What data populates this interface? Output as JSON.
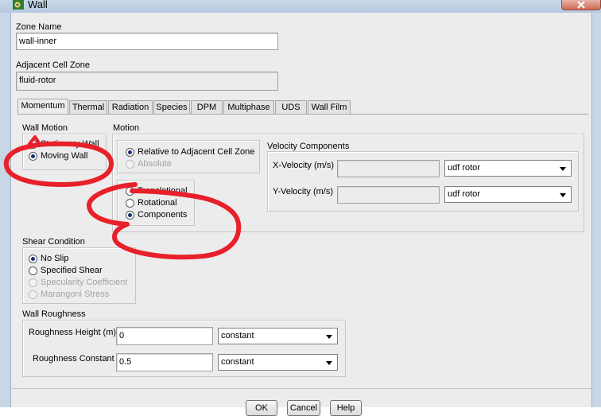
{
  "window": {
    "title": "Wall"
  },
  "zone_name": {
    "label": "Zone Name",
    "value": "wall-inner"
  },
  "adjacent_cell_zone": {
    "label": "Adjacent Cell Zone",
    "value": "fluid-rotor"
  },
  "tabs": [
    {
      "label": "Momentum",
      "active": true
    },
    {
      "label": "Thermal",
      "active": false
    },
    {
      "label": "Radiation",
      "active": false
    },
    {
      "label": "Species",
      "active": false
    },
    {
      "label": "DPM",
      "active": false
    },
    {
      "label": "Multiphase",
      "active": false
    },
    {
      "label": "UDS",
      "active": false
    },
    {
      "label": "Wall Film",
      "active": false
    }
  ],
  "wall_motion": {
    "title": "Wall Motion",
    "options": [
      {
        "label": "Stationary Wall",
        "selected": false
      },
      {
        "label": "Moving Wall",
        "selected": true
      }
    ]
  },
  "motion": {
    "title": "Motion",
    "reference": [
      {
        "label": "Relative to Adjacent Cell Zone",
        "selected": true,
        "enabled": true
      },
      {
        "label": "Absolute",
        "selected": false,
        "enabled": false
      }
    ],
    "type": [
      {
        "label": "Translational",
        "selected": false
      },
      {
        "label": "Rotational",
        "selected": false
      },
      {
        "label": "Components",
        "selected": true
      }
    ]
  },
  "velocity_components": {
    "title": "Velocity Components",
    "x": {
      "label": "X-Velocity (m/s)",
      "value": "",
      "method": "udf rotor"
    },
    "y": {
      "label": "Y-Velocity (m/s)",
      "value": "",
      "method": "udf rotor"
    }
  },
  "shear_condition": {
    "title": "Shear Condition",
    "options": [
      {
        "label": "No Slip",
        "selected": true,
        "enabled": true
      },
      {
        "label": "Specified Shear",
        "selected": false,
        "enabled": true
      },
      {
        "label": "Specularity Coefficient",
        "selected": false,
        "enabled": false
      },
      {
        "label": "Marangoni Stress",
        "selected": false,
        "enabled": false
      }
    ]
  },
  "wall_roughness": {
    "title": "Wall Roughness",
    "height": {
      "label": "Roughness Height (m)",
      "value": "0",
      "method": "constant"
    },
    "constant": {
      "label": "Roughness Constant",
      "value": "0.5",
      "method": "constant"
    }
  },
  "buttons": {
    "ok": "OK",
    "cancel": "Cancel",
    "help": "Help"
  },
  "annotations": {
    "color": "#e8202a"
  }
}
